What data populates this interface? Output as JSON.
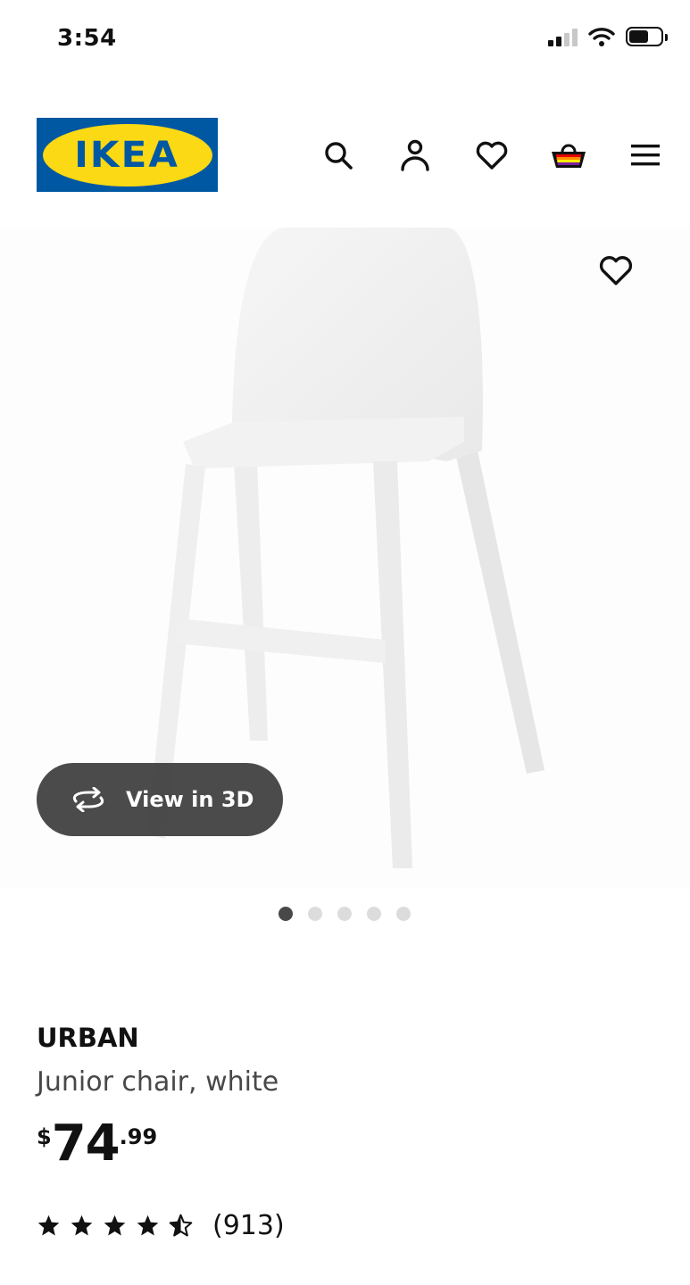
{
  "status_bar": {
    "time": "3:54",
    "icons": [
      "cellular-signal-icon",
      "wifi-icon",
      "battery-icon"
    ]
  },
  "header": {
    "logo_text": "IKEA",
    "icons": [
      "search-icon",
      "account-icon",
      "wishlist-heart-icon",
      "shopping-bag-icon",
      "menu-icon"
    ]
  },
  "gallery": {
    "view3d_label": "View in 3D",
    "dot_count": 5,
    "active_dot": 1
  },
  "product": {
    "name": "URBAN",
    "description": "Junior chair, white",
    "price_currency": "$",
    "price_integer": "74",
    "price_decimal": ".99",
    "rating_stars": 4.5,
    "review_count": "(913)"
  },
  "colors": {
    "ikea_blue": "#0058a3",
    "ikea_yellow": "#fbd914",
    "text_primary": "#111111",
    "text_secondary": "#484848",
    "pill_bg": "#3c3c3c"
  }
}
